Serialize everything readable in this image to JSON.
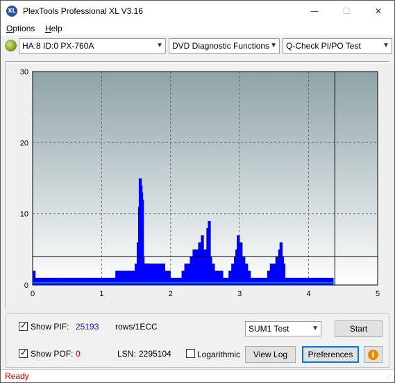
{
  "window": {
    "title": "PlexTools Professional XL V3.16",
    "icon_text": "XL",
    "minimize": "—",
    "maximize": "☐",
    "close": "✕"
  },
  "menu": {
    "options": {
      "mnemonic": "O",
      "rest": "ptions"
    },
    "help": {
      "mnemonic": "H",
      "rest": "elp"
    }
  },
  "toolbar": {
    "drive": "HA:8 ID:0  PX-760A",
    "function": "DVD Diagnostic Functions",
    "test": "Q-Check PI/PO Test"
  },
  "chart_data": {
    "type": "bar",
    "xlim": [
      0,
      5
    ],
    "ylim": [
      0,
      30
    ],
    "x_ticks": [
      "0",
      "1",
      "2",
      "3",
      "4",
      "5"
    ],
    "y_ticks": [
      "0",
      "10",
      "20",
      "30"
    ],
    "grid": true,
    "threshold": 4,
    "end_marker_x": 4.38,
    "series": [
      {
        "color": "#0000ff",
        "x": [
          0.02,
          0.06,
          0.1,
          0.14,
          0.18,
          0.22,
          0.26,
          0.3,
          0.34,
          0.38,
          0.42,
          0.46,
          0.5,
          0.54,
          0.58,
          0.62,
          0.66,
          0.7,
          0.74,
          0.78,
          0.82,
          0.86,
          0.9,
          0.94,
          0.98,
          1.02,
          1.06,
          1.1,
          1.14,
          1.18,
          1.22,
          1.26,
          1.3,
          1.34,
          1.38,
          1.42,
          1.46,
          1.5,
          1.53,
          1.55,
          1.56,
          1.57,
          1.58,
          1.59,
          1.6,
          1.62,
          1.64,
          1.66,
          1.68,
          1.7,
          1.74,
          1.78,
          1.82,
          1.86,
          1.9,
          1.94,
          1.98,
          2.02,
          2.06,
          2.1,
          2.14,
          2.18,
          2.22,
          2.26,
          2.3,
          2.34,
          2.38,
          2.42,
          2.46,
          2.5,
          2.54,
          2.56,
          2.58,
          2.62,
          2.66,
          2.7,
          2.74,
          2.78,
          2.82,
          2.86,
          2.9,
          2.94,
          2.96,
          2.98,
          3.02,
          3.06,
          3.1,
          3.14,
          3.18,
          3.22,
          3.26,
          3.3,
          3.34,
          3.38,
          3.42,
          3.46,
          3.5,
          3.54,
          3.58,
          3.6,
          3.62,
          3.64,
          3.66,
          3.7,
          3.74,
          3.78,
          3.82,
          3.86,
          3.9,
          3.94,
          3.98,
          4.02,
          4.06,
          4.1,
          4.14,
          4.18,
          4.22,
          4.26,
          4.3,
          4.34
        ],
        "values": [
          2,
          1,
          1,
          1,
          1,
          1,
          1,
          1,
          1,
          1,
          1,
          1,
          1,
          1,
          1,
          1,
          1,
          1,
          1,
          1,
          1,
          1,
          1,
          1,
          1,
          1,
          1,
          1,
          1,
          1,
          2,
          2,
          2,
          2,
          2,
          2,
          2,
          3,
          6,
          11,
          15,
          14,
          13,
          12,
          4,
          3,
          3,
          3,
          3,
          3,
          3,
          3,
          3,
          3,
          3,
          2,
          2,
          1,
          1,
          1,
          1,
          2,
          3,
          3,
          4,
          5,
          5,
          6,
          7,
          5,
          8,
          9,
          4,
          3,
          2,
          2,
          2,
          1,
          1,
          2,
          3,
          4,
          5,
          7,
          6,
          4,
          3,
          2,
          1,
          1,
          1,
          1,
          1,
          1,
          2,
          3,
          3,
          4,
          5,
          6,
          4,
          3,
          1,
          1,
          1,
          1,
          1,
          1,
          1,
          1,
          1,
          1,
          1,
          1,
          1,
          1,
          1,
          1,
          1,
          1
        ]
      }
    ]
  },
  "bottom": {
    "show_pif_label": "Show PIF:",
    "pif_value": "25193",
    "pif_unit": "rows/1ECC",
    "show_pof_label": "Show POF:",
    "pof_value": "0",
    "lsn_label": "LSN:",
    "lsn_value": "2295104",
    "logarithmic_label": "Logarithmic",
    "test_select": "SUM1 Test",
    "start_label": "Start",
    "view_log_label": "View Log",
    "preferences_label": "Preferences",
    "info_icon": "i"
  },
  "status": {
    "text": "Ready"
  },
  "colors": {
    "status_text": "#c00000",
    "pif_value": "#1a1aa6",
    "pof_value": "#c00000",
    "plot_series": "#0000ff"
  }
}
